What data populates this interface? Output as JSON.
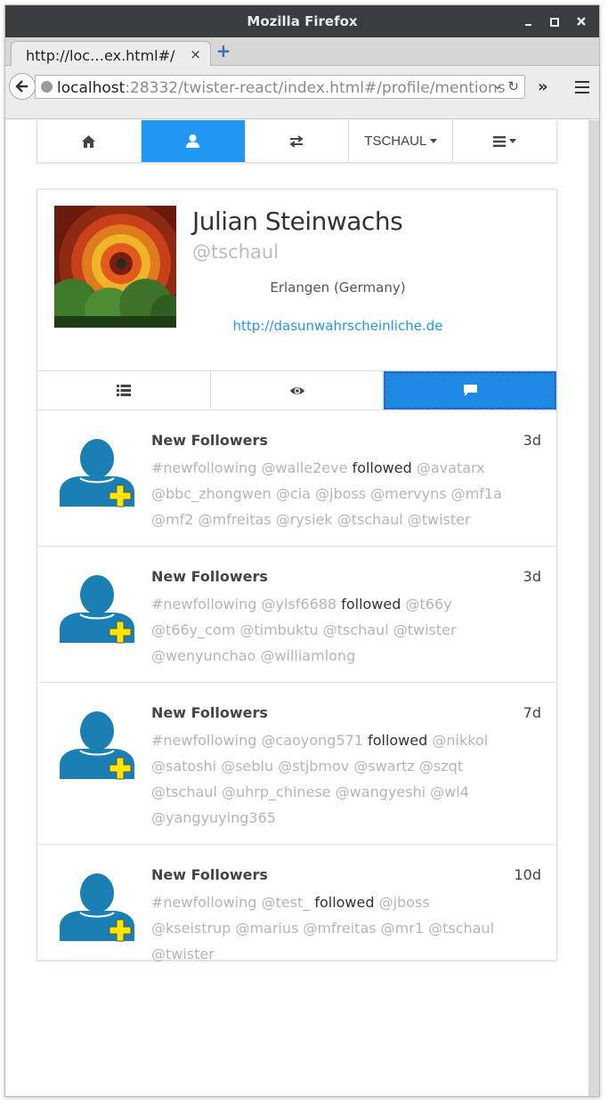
{
  "browser": {
    "window_title": "Mozilla Firefox",
    "tab_title": "http://loc…ex.html#/",
    "tab_close": "×",
    "new_tab": "+",
    "url_host": "localhost",
    "url_rest": ":28332/twister-react/index.html#/profile/mentions",
    "url_dropdown": "⌄",
    "url_reload": "↻",
    "overflow": "»"
  },
  "nav": {
    "items": [
      {
        "icon": "home-icon"
      },
      {
        "icon": "user-icon",
        "active": true
      },
      {
        "icon": "exchange-icon"
      },
      {
        "label": "TSCHAUL"
      },
      {
        "icon": "menu-icon"
      }
    ]
  },
  "profile": {
    "name": "Julian Steinwachs",
    "handle": "@tschaul",
    "location": "Erlangen (Germany)",
    "website": "http://dasunwahrscheinliche.de"
  },
  "subtabs": [
    {
      "icon": "list-icon"
    },
    {
      "icon": "eye-icon"
    },
    {
      "icon": "comment-icon",
      "active": true
    }
  ],
  "accent": "#2196f3",
  "posts": [
    {
      "title": "New Followers",
      "time": "3d",
      "tag": "#newfollowing",
      "who": "@walle2eve",
      "verb": "followed",
      "rest": "@avatarx @bbc_zhongwen @cia @jboss @mervyns @mf1a @mf2 @mfreitas @rysiek @tschaul @twister"
    },
    {
      "title": "New Followers",
      "time": "3d",
      "tag": "#newfollowing",
      "who": "@ylsf6688",
      "verb": "followed",
      "rest": "@t66y @t66y_com @timbuktu @tschaul @twister @wenyunchao @williamlong"
    },
    {
      "title": "New Followers",
      "time": "7d",
      "tag": "#newfollowing",
      "who": "@caoyong571",
      "verb": "followed",
      "rest": "@nikkol @satoshi @seblu @stjbmov @swartz @szqt @tschaul @uhrp_chinese @wangyeshi @wl4 @yangyuying365"
    },
    {
      "title": "New Followers",
      "time": "10d",
      "tag": "#newfollowing",
      "who": "@test_",
      "verb": "followed",
      "rest": "@jboss @kseistrup @marius @mfreitas @mr1 @tschaul @twister"
    }
  ]
}
